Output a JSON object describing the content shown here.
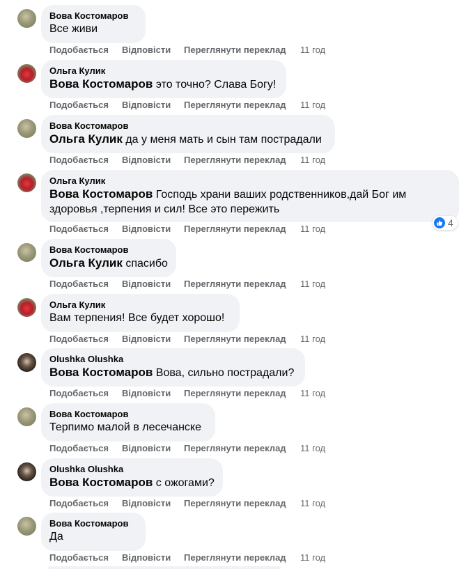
{
  "actions": {
    "like": "Подобається",
    "reply": "Відповісти",
    "translate": "Переглянути переклад"
  },
  "comments": [
    {
      "author": "Вова Костомаров",
      "mention": "",
      "text": "Все живи",
      "time": "11 год",
      "avatar": "vova-avatar"
    },
    {
      "author": "Ольга Кулик",
      "mention": "Вова Костомаров",
      "text": " это точно? Слава Богу!",
      "time": "11 год",
      "avatar": "olga-avatar"
    },
    {
      "author": "Вова Костомаров",
      "mention": "Ольга Кулик",
      "text": " да у меня мать и сын там пострадали",
      "time": "11 год",
      "avatar": "vova-avatar"
    },
    {
      "author": "Ольга Кулик",
      "mention": "Вова Костомаров",
      "text": " Господь храни ваших родственников,дай Бог им здоровья ,терпения и сил! Все это пережить",
      "time": "11 год",
      "avatar": "olga-avatar",
      "reactions": {
        "icon": "like-icon",
        "count": "4"
      }
    },
    {
      "author": "Вова Костомаров",
      "mention": "Ольга Кулик",
      "text": " спасибо",
      "time": "11 год",
      "avatar": "vova-avatar"
    },
    {
      "author": "Ольга Кулик",
      "mention": "",
      "text": "Вам терпения! Все будет хорошо!",
      "time": "11 год",
      "avatar": "olga-avatar"
    },
    {
      "author": "Olushka Olushka",
      "mention": "Вова Костомаров",
      "text": " Вова, сильно пострадали?",
      "time": "11 год",
      "avatar": "olushka-avatar"
    },
    {
      "author": "Вова Костомаров",
      "mention": "",
      "text": "Терпимо малой в лесечанске",
      "time": "11 год",
      "avatar": "vova-avatar"
    },
    {
      "author": "Olushka Olushka",
      "mention": "Вова Костомаров",
      "text": " с ожогами?",
      "time": "11 год",
      "avatar": "olushka-avatar"
    },
    {
      "author": "Вова Костомаров",
      "mention": "",
      "text": "Да",
      "time": "11 год",
      "avatar": "vova-avatar"
    }
  ]
}
